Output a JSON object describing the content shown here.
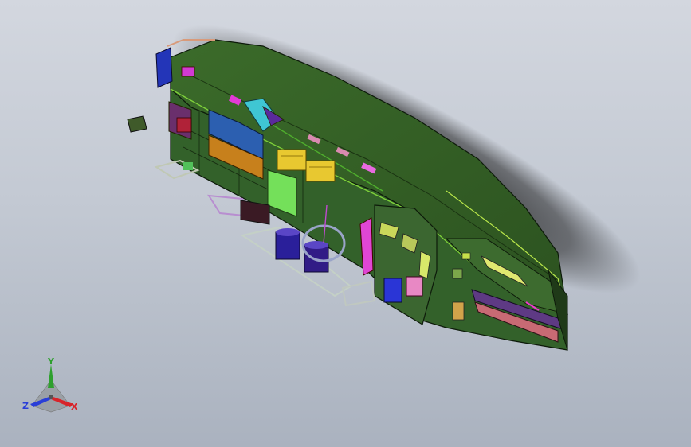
{
  "viewport": {
    "colors": {
      "background_top": "#d3d7df",
      "background_bottom": "#aab2bf",
      "hull": "#2f5a22",
      "edge": "#0d1a0a"
    }
  },
  "triad": {
    "x_label": "X",
    "y_label": "Y",
    "z_label": "Z",
    "colors": {
      "x": "#d8242a",
      "y": "#2ea02e",
      "z": "#2a3fd8"
    }
  }
}
